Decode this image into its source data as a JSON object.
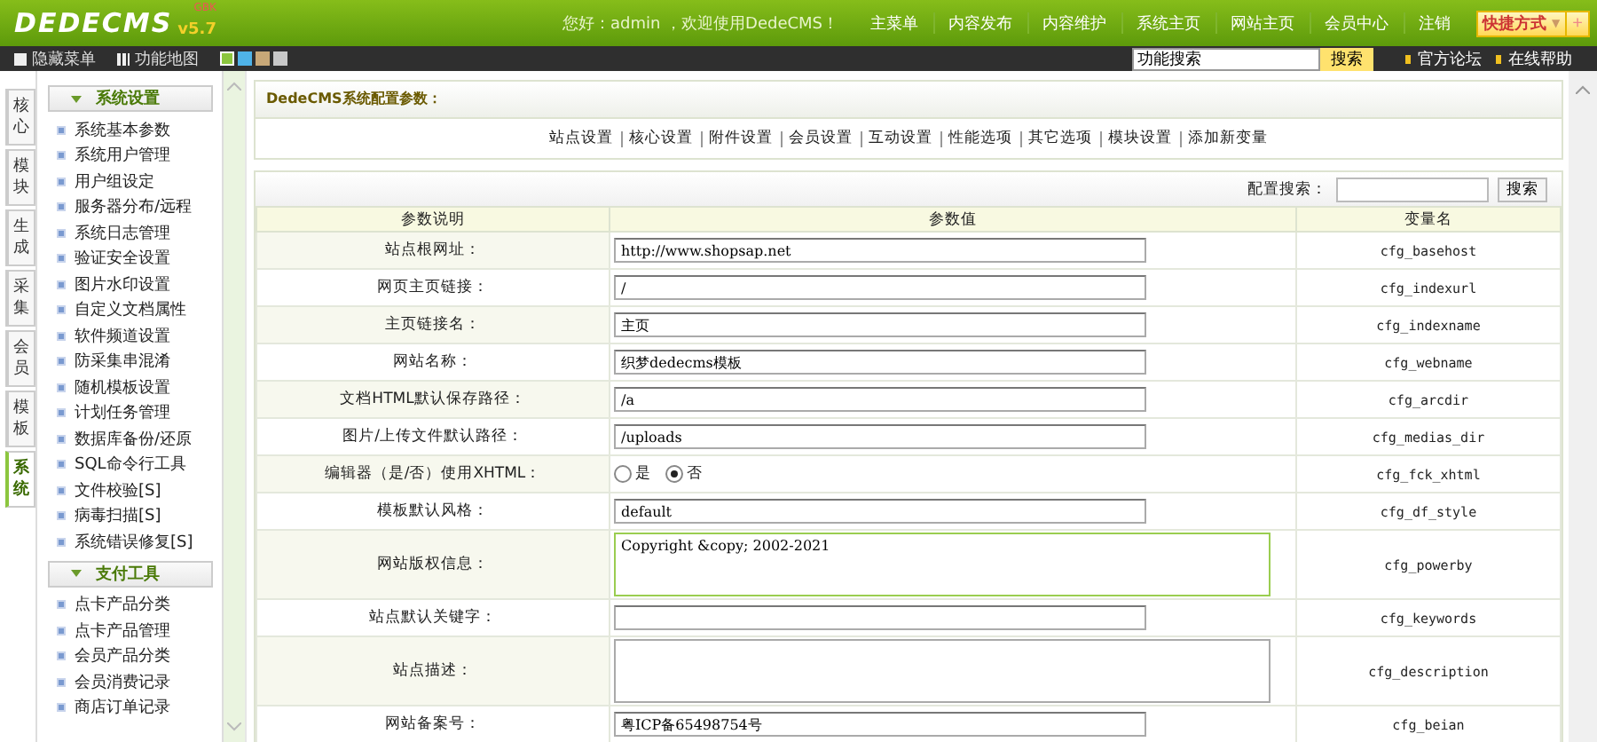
{
  "logo": {
    "name": "DEDECMS",
    "version": "v5.7",
    "edition": "GBK"
  },
  "greeting": "您好：admin ，欢迎使用DedeCMS！",
  "top_nav": [
    "主菜单",
    "内容发布",
    "内容维护",
    "系统主页",
    "网站主页",
    "会员中心",
    "注销"
  ],
  "shortcut": {
    "label": "快捷方式",
    "caret": "▼",
    "add": "+"
  },
  "toolbar": {
    "hide_menu": "隐藏菜单",
    "site_map": "功能地图",
    "skins": [
      {
        "color": "#8cc63f",
        "selected": true
      },
      {
        "color": "#4fb3e8",
        "selected": false
      },
      {
        "color": "#c8a878",
        "selected": false
      },
      {
        "color": "#c8c8c8",
        "selected": false
      }
    ],
    "search": {
      "value": "功能搜索"
    },
    "search_button": "搜索",
    "links": [
      "官方论坛",
      "在线帮助"
    ]
  },
  "side_tabs": [
    {
      "label": "核心",
      "selected": false
    },
    {
      "label": "模块",
      "selected": false
    },
    {
      "label": "生成",
      "selected": false
    },
    {
      "label": "采集",
      "selected": false
    },
    {
      "label": "会员",
      "selected": false
    },
    {
      "label": "模板",
      "selected": false
    },
    {
      "label": "系统",
      "selected": true
    }
  ],
  "menu_groups": [
    {
      "title": "系统设置",
      "expanded": true,
      "items": [
        "系统基本参数",
        "系统用户管理",
        "用户组设定",
        "服务器分布/远程",
        "系统日志管理",
        "验证安全设置",
        "图片水印设置",
        "自定义文档属性",
        "软件频道设置",
        "防采集串混淆",
        "随机模板设置",
        "计划任务管理",
        "数据库备份/还原",
        "SQL命令行工具",
        "文件校验[S]",
        "病毒扫描[S]",
        "系统错误修复[S]"
      ]
    },
    {
      "title": "支付工具",
      "expanded": true,
      "items": [
        "点卡产品分类",
        "点卡产品管理",
        "会员产品分类",
        "会员消费记录",
        "商店订单记录"
      ]
    }
  ],
  "panel_title": "DedeCMS系统配置参数：",
  "config_tabs": [
    "站点设置",
    "核心设置",
    "附件设置",
    "会员设置",
    "互动设置",
    "性能选项",
    "其它选项",
    "模块设置",
    "添加新变量"
  ],
  "config_search": {
    "label": "配置搜索：",
    "button": "搜索"
  },
  "table": {
    "columns": [
      "参数说明",
      "参数值",
      "变量名"
    ],
    "rows": [
      {
        "label": "站点根网址：",
        "kind": "text",
        "value": "http://www.shopsap.net",
        "var": "cfg_basehost"
      },
      {
        "label": "网页主页链接：",
        "kind": "text",
        "value": "/",
        "var": "cfg_indexurl"
      },
      {
        "label": "主页链接名：",
        "kind": "text",
        "value": "主页",
        "var": "cfg_indexname"
      },
      {
        "label": "网站名称：",
        "kind": "text",
        "value": "织梦dedecms模板",
        "var": "cfg_webname"
      },
      {
        "label": "文档HTML默认保存路径：",
        "kind": "text",
        "value": "/a",
        "var": "cfg_arcdir"
      },
      {
        "label": "图片/上传文件默认路径：",
        "kind": "text",
        "value": "/uploads",
        "var": "cfg_medias_dir"
      },
      {
        "label": "编辑器（是/否）使用XHTML：",
        "kind": "radio",
        "options": [
          {
            "label": "是",
            "selected": false
          },
          {
            "label": "否",
            "selected": true
          }
        ],
        "var": "cfg_fck_xhtml"
      },
      {
        "label": "模板默认风格：",
        "kind": "text",
        "value": "default",
        "var": "cfg_df_style"
      },
      {
        "label": "网站版权信息：",
        "kind": "textarea",
        "value": "Copyright &copy; 2002-2021",
        "focused": true,
        "var": "cfg_powerby"
      },
      {
        "label": "站点默认关键字：",
        "kind": "text",
        "var": "cfg_keywords"
      },
      {
        "label": "站点描述：",
        "kind": "textarea",
        "focused": false,
        "var": "cfg_description"
      },
      {
        "label": "网站备案号：",
        "kind": "text",
        "value": "粤ICP备65498754号",
        "var": "cfg_beian"
      }
    ]
  }
}
